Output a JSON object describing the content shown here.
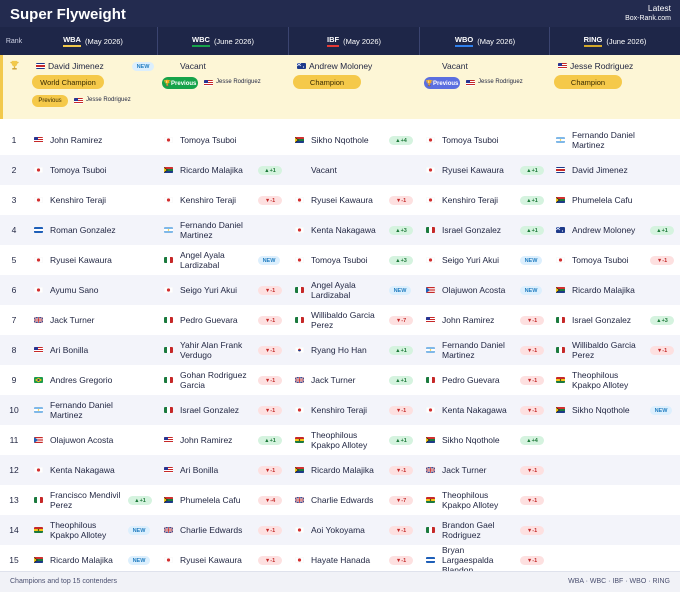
{
  "title": "Super Flyweight",
  "latest": "Latest",
  "site": "Box-Rank.com",
  "rank_header": "Rank",
  "colors": {
    "WBA": "#f2c94c",
    "WBC": "#16a34a",
    "IBF": "#e53935",
    "WBO": "#2f80ed",
    "RING": "#d4a82a"
  },
  "orgs": [
    {
      "org": "WBA",
      "date": "(May 2026)"
    },
    {
      "org": "WBC",
      "date": "(June 2026)"
    },
    {
      "org": "IBF",
      "date": "(May 2026)"
    },
    {
      "org": "WBO",
      "date": "(May 2026)"
    },
    {
      "org": "RING",
      "date": "(June 2026)"
    }
  ],
  "champions": [
    {
      "name": "David Jimenez",
      "flag": "cr",
      "badge": "NEW",
      "pill": "World Champion",
      "pill_style": "gold",
      "prev_label": "Previous",
      "prev_style": "gold",
      "prev_name": "Jesse Rodriguez",
      "prev_flag": "us"
    },
    {
      "name": "Vacant",
      "flag": "",
      "badge": "",
      "pill": "",
      "pill_style": "",
      "prev_label": "Previous",
      "prev_style": "green",
      "prev_name": "Jesse Rodriguez",
      "prev_flag": "us"
    },
    {
      "name": "Andrew Moloney",
      "flag": "au",
      "badge": "",
      "pill": "Champion",
      "pill_style": "gold",
      "prev_label": "",
      "prev_style": "",
      "prev_name": "",
      "prev_flag": ""
    },
    {
      "name": "Vacant",
      "flag": "",
      "badge": "",
      "pill": "",
      "pill_style": "",
      "prev_label": "Previous",
      "prev_style": "blue",
      "prev_name": "Jesse Rodriguez",
      "prev_flag": "us"
    },
    {
      "name": "Jesse Rodriguez",
      "flag": "us",
      "badge": "",
      "pill": "Champion",
      "pill_style": "gold",
      "prev_label": "",
      "prev_style": "",
      "prev_name": "",
      "prev_flag": ""
    }
  ],
  "rows": [
    {
      "rank": "1",
      "cells": [
        {
          "lines": [
            "John Ramirez"
          ],
          "flag": "us",
          "badge": ""
        },
        {
          "lines": [
            "Tomoya Tsuboi"
          ],
          "flag": "jp",
          "badge": ""
        },
        {
          "lines": [
            "Sikho Nqothole"
          ],
          "flag": "za",
          "badge": "▲+4"
        },
        {
          "lines": [
            "Tomoya Tsuboi"
          ],
          "flag": "jp",
          "badge": ""
        },
        {
          "lines": [
            "Fernando Daniel",
            "Martinez"
          ],
          "flag": "ar",
          "badge": ""
        }
      ]
    },
    {
      "rank": "2",
      "cells": [
        {
          "lines": [
            "Tomoya Tsuboi"
          ],
          "flag": "jp",
          "badge": ""
        },
        {
          "lines": [
            "Ricardo Malajika"
          ],
          "flag": "za",
          "badge": "▲+1"
        },
        {
          "lines": [
            "Vacant"
          ],
          "flag": "",
          "badge": ""
        },
        {
          "lines": [
            "Ryusei Kawaura"
          ],
          "flag": "jp",
          "badge": "▲+1"
        },
        {
          "lines": [
            "David Jimenez"
          ],
          "flag": "cr",
          "badge": ""
        }
      ]
    },
    {
      "rank": "3",
      "cells": [
        {
          "lines": [
            "Kenshiro Teraji"
          ],
          "flag": "jp",
          "badge": ""
        },
        {
          "lines": [
            "Kenshiro Teraji"
          ],
          "flag": "jp",
          "badge": "▼-1"
        },
        {
          "lines": [
            "Ryusei Kawaura"
          ],
          "flag": "jp",
          "badge": "▼-1"
        },
        {
          "lines": [
            "Kenshiro Teraji"
          ],
          "flag": "jp",
          "badge": "▲+1"
        },
        {
          "lines": [
            "Phumelela Cafu"
          ],
          "flag": "za",
          "badge": ""
        }
      ]
    },
    {
      "rank": "4",
      "cells": [
        {
          "lines": [
            "Roman Gonzalez"
          ],
          "flag": "ni",
          "badge": ""
        },
        {
          "lines": [
            "Fernando Daniel",
            "Martinez"
          ],
          "flag": "ar",
          "badge": ""
        },
        {
          "lines": [
            "Kenta Nakagawa"
          ],
          "flag": "jp",
          "badge": "▲+3"
        },
        {
          "lines": [
            "Israel Gonzalez"
          ],
          "flag": "mx",
          "badge": "▲+1"
        },
        {
          "lines": [
            "Andrew Moloney"
          ],
          "flag": "au",
          "badge": "▲+1"
        }
      ]
    },
    {
      "rank": "5",
      "cells": [
        {
          "lines": [
            "Ryusei Kawaura"
          ],
          "flag": "jp",
          "badge": ""
        },
        {
          "lines": [
            "Angel Ayala",
            "Lardizabal"
          ],
          "flag": "mx",
          "badge": "NEW"
        },
        {
          "lines": [
            "Tomoya Tsuboi"
          ],
          "flag": "jp",
          "badge": "▲+3"
        },
        {
          "lines": [
            "Seigo Yuri Akui"
          ],
          "flag": "jp",
          "badge": "NEW"
        },
        {
          "lines": [
            "Tomoya Tsuboi"
          ],
          "flag": "jp",
          "badge": "▼-1"
        }
      ]
    },
    {
      "rank": "6",
      "cells": [
        {
          "lines": [
            "Ayumu Sano"
          ],
          "flag": "jp",
          "badge": ""
        },
        {
          "lines": [
            "Seigo Yuri Akui"
          ],
          "flag": "jp",
          "badge": "▼-1"
        },
        {
          "lines": [
            "Angel Ayala",
            "Lardizabal"
          ],
          "flag": "mx",
          "badge": "NEW"
        },
        {
          "lines": [
            "Olajuwon Acosta"
          ],
          "flag": "pr",
          "badge": "NEW"
        },
        {
          "lines": [
            "Ricardo Malajika"
          ],
          "flag": "za",
          "badge": ""
        }
      ]
    },
    {
      "rank": "7",
      "cells": [
        {
          "lines": [
            "Jack Turner"
          ],
          "flag": "gb",
          "badge": ""
        },
        {
          "lines": [
            "Pedro Guevara"
          ],
          "flag": "mx",
          "badge": "▼-1"
        },
        {
          "lines": [
            "Willibaldo Garcia",
            "Perez"
          ],
          "flag": "mx",
          "badge": "▼-7"
        },
        {
          "lines": [
            "John Ramirez"
          ],
          "flag": "us",
          "badge": "▼-1"
        },
        {
          "lines": [
            "Israel Gonzalez"
          ],
          "flag": "mx",
          "badge": "▲+3"
        }
      ]
    },
    {
      "rank": "8",
      "cells": [
        {
          "lines": [
            "Ari Bonilla"
          ],
          "flag": "us",
          "badge": ""
        },
        {
          "lines": [
            "Yahir Alan Frank",
            "Verdugo"
          ],
          "flag": "mx",
          "badge": "▼-1"
        },
        {
          "lines": [
            "Ryang Ho Han"
          ],
          "flag": "kr",
          "badge": "▲+1"
        },
        {
          "lines": [
            "Fernando Daniel",
            "Martinez"
          ],
          "flag": "ar",
          "badge": "▼-1"
        },
        {
          "lines": [
            "Willibaldo Garcia",
            "Perez"
          ],
          "flag": "mx",
          "badge": "▼-1"
        }
      ]
    },
    {
      "rank": "9",
      "cells": [
        {
          "lines": [
            "Andres Gregorio"
          ],
          "flag": "br",
          "badge": ""
        },
        {
          "lines": [
            "Gohan Rodriguez",
            "Garcia"
          ],
          "flag": "mx",
          "badge": "▼-1"
        },
        {
          "lines": [
            "Jack Turner"
          ],
          "flag": "gb",
          "badge": "▲+1"
        },
        {
          "lines": [
            "Pedro Guevara"
          ],
          "flag": "mx",
          "badge": "▼-1"
        },
        {
          "lines": [
            "Theophilous",
            "Kpakpo Allotey"
          ],
          "flag": "gh",
          "badge": ""
        }
      ]
    },
    {
      "rank": "10",
      "cells": [
        {
          "lines": [
            "Fernando Daniel",
            "Martinez"
          ],
          "flag": "ar",
          "badge": ""
        },
        {
          "lines": [
            "Israel Gonzalez"
          ],
          "flag": "mx",
          "badge": "▼-1"
        },
        {
          "lines": [
            "Kenshiro Teraji"
          ],
          "flag": "jp",
          "badge": "▼-1"
        },
        {
          "lines": [
            "Kenta Nakagawa"
          ],
          "flag": "jp",
          "badge": "▼-1"
        },
        {
          "lines": [
            "Sikho Nqothole"
          ],
          "flag": "za",
          "badge": "NEW"
        }
      ]
    },
    {
      "rank": "11",
      "cells": [
        {
          "lines": [
            "Olajuwon Acosta"
          ],
          "flag": "pr",
          "badge": ""
        },
        {
          "lines": [
            "John Ramirez"
          ],
          "flag": "us",
          "badge": "▲+1"
        },
        {
          "lines": [
            "Theophilous",
            "Kpakpo Allotey"
          ],
          "flag": "gh",
          "badge": "▲+1"
        },
        {
          "lines": [
            "Sikho Nqothole"
          ],
          "flag": "za",
          "badge": "▲+4"
        },
        {
          "lines": [],
          "flag": "",
          "badge": ""
        }
      ]
    },
    {
      "rank": "12",
      "cells": [
        {
          "lines": [
            "Kenta Nakagawa"
          ],
          "flag": "jp",
          "badge": ""
        },
        {
          "lines": [
            "Ari Bonilla"
          ],
          "flag": "us",
          "badge": "▼-1"
        },
        {
          "lines": [
            "Ricardo Malajika"
          ],
          "flag": "za",
          "badge": "▼-1"
        },
        {
          "lines": [
            "Jack Turner"
          ],
          "flag": "gb",
          "badge": "▼-1"
        },
        {
          "lines": [],
          "flag": "",
          "badge": ""
        }
      ]
    },
    {
      "rank": "13",
      "cells": [
        {
          "lines": [
            "Francisco Mendivil",
            "Perez"
          ],
          "flag": "mx",
          "badge": "▲+1"
        },
        {
          "lines": [
            "Phumelela Cafu"
          ],
          "flag": "za",
          "badge": "▼-4"
        },
        {
          "lines": [
            "Charlie Edwards"
          ],
          "flag": "gb",
          "badge": "▼-7"
        },
        {
          "lines": [
            "Theophilous",
            "Kpakpo Allotey"
          ],
          "flag": "gh",
          "badge": "▼-1"
        },
        {
          "lines": [],
          "flag": "",
          "badge": ""
        }
      ]
    },
    {
      "rank": "14",
      "cells": [
        {
          "lines": [
            "Theophilous",
            "Kpakpo Allotey"
          ],
          "flag": "gh",
          "badge": "NEW"
        },
        {
          "lines": [
            "Charlie Edwards"
          ],
          "flag": "gb",
          "badge": "▼-1"
        },
        {
          "lines": [
            "Aoi Yokoyama"
          ],
          "flag": "jp",
          "badge": "▼-1"
        },
        {
          "lines": [
            "Brandon Gael",
            "Rodriguez"
          ],
          "flag": "mx",
          "badge": "▼-1"
        },
        {
          "lines": [],
          "flag": "",
          "badge": ""
        }
      ]
    },
    {
      "rank": "15",
      "cells": [
        {
          "lines": [
            "Ricardo Malajika"
          ],
          "flag": "za",
          "badge": "NEW"
        },
        {
          "lines": [
            "Ryusei Kawaura"
          ],
          "flag": "jp",
          "badge": "▼-1"
        },
        {
          "lines": [
            "Hayate Hanada"
          ],
          "flag": "jp",
          "badge": "▼-1"
        },
        {
          "lines": [
            "Bryan",
            "Largaespalda",
            "Blandon"
          ],
          "flag": "ni",
          "badge": "▼-1"
        },
        {
          "lines": [],
          "flag": "",
          "badge": ""
        }
      ]
    }
  ],
  "footer_left": "Champions and top 15 contenders",
  "footer_right": "WBA · WBC · IBF · WBO · RING"
}
